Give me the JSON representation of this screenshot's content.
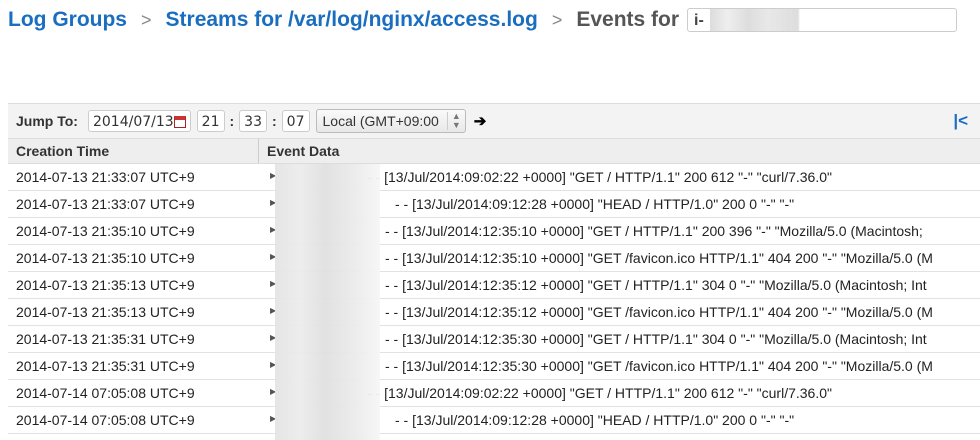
{
  "breadcrumb": {
    "log_groups": "Log Groups",
    "streams": "Streams for /var/log/nginx/access.log",
    "events": "Events for",
    "instance": "i-"
  },
  "toolbar": {
    "jump_to": "Jump To:",
    "date": "2014/07/13",
    "hour": "21",
    "minute": "33",
    "second": "07",
    "timezone": "Local (GMT+09:00",
    "go_icon": "arrow-right",
    "first_icon": "skip-to-first"
  },
  "table": {
    "headers": [
      "Creation Time",
      "Event Data"
    ],
    "rows": [
      {
        "time": "2014-07-13 21:33:07 UTC+9",
        "event": "- - [13/Jul/2014:09:02:22 +0000] \"GET / HTTP/1.1\" 200 612 \"-\" \"curl/7.36.0\""
      },
      {
        "time": "2014-07-13 21:33:07 UTC+9",
        "event": "- - [13/Jul/2014:09:12:28 +0000] \"HEAD / HTTP/1.0\" 200 0 \"-\" \"-\""
      },
      {
        "time": "2014-07-13 21:35:10 UTC+9",
        "event": "- - [13/Jul/2014:12:35:10 +0000] \"GET / HTTP/1.1\" 200 396 \"-\" \"Mozilla/5.0 (Macintosh;"
      },
      {
        "time": "2014-07-13 21:35:10 UTC+9",
        "event": "- - [13/Jul/2014:12:35:10 +0000] \"GET /favicon.ico HTTP/1.1\" 404 200 \"-\" \"Mozilla/5.0 (M"
      },
      {
        "time": "2014-07-13 21:35:13 UTC+9",
        "event": "- - [13/Jul/2014:12:35:12 +0000] \"GET / HTTP/1.1\" 304 0 \"-\" \"Mozilla/5.0 (Macintosh; Int"
      },
      {
        "time": "2014-07-13 21:35:13 UTC+9",
        "event": "- - [13/Jul/2014:12:35:12 +0000] \"GET /favicon.ico HTTP/1.1\" 404 200 \"-\" \"Mozilla/5.0 (M"
      },
      {
        "time": "2014-07-13 21:35:31 UTC+9",
        "event": "- - [13/Jul/2014:12:35:30 +0000] \"GET / HTTP/1.1\" 304 0 \"-\" \"Mozilla/5.0 (Macintosh; Int"
      },
      {
        "time": "2014-07-13 21:35:31 UTC+9",
        "event": "- - [13/Jul/2014:12:35:30 +0000] \"GET /favicon.ico HTTP/1.1\" 404 200 \"-\" \"Mozilla/5.0 (M"
      },
      {
        "time": "2014-07-14 07:05:08 UTC+9",
        "event": "- - [13/Jul/2014:09:02:22 +0000] \"GET / HTTP/1.1\" 200 612 \"-\" \"curl/7.36.0\""
      },
      {
        "time": "2014-07-14 07:05:08 UTC+9",
        "event": "- - [13/Jul/2014:09:12:28 +0000] \"HEAD / HTTP/1.0\" 200 0 \"-\" \"-\""
      }
    ]
  },
  "colors": {
    "link": "#1a6ec0"
  }
}
